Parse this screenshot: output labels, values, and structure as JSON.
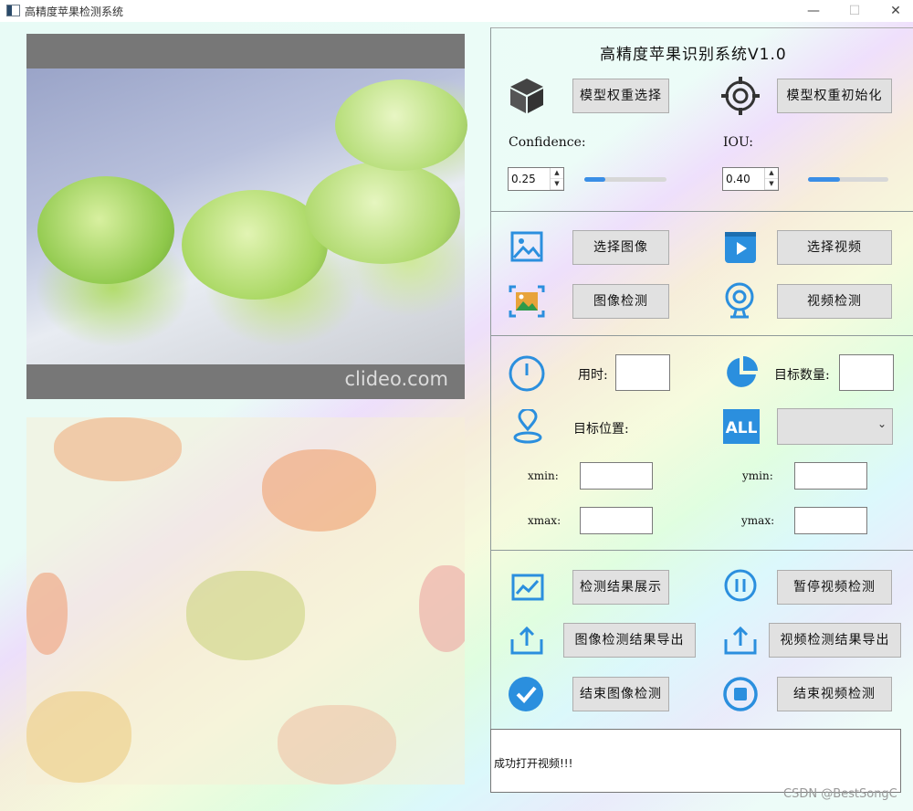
{
  "window": {
    "title": "高精度苹果检测系统",
    "controls": {
      "minimize": "—",
      "maximize": "☐",
      "close": "✕"
    }
  },
  "video": {
    "watermark": "clideo.com"
  },
  "app": {
    "heading": "高精度苹果识别系统V1.0"
  },
  "model": {
    "select_weights_label": "模型权重选择",
    "init_weights_label": "模型权重初始化"
  },
  "params": {
    "confidence_label": "Confidence:",
    "confidence_value": "0.25",
    "confidence_slider": 0.25,
    "iou_label": "IOU:",
    "iou_value": "0.40",
    "iou_slider": 0.4
  },
  "actions": {
    "select_image": "选择图像",
    "select_video": "选择视频",
    "detect_image": "图像检测",
    "detect_video": "视频检测"
  },
  "results": {
    "time_label": "用时:",
    "time_value": "",
    "count_label": "目标数量:",
    "count_value": "",
    "position_label": "目标位置:",
    "target_select_value": "",
    "xmin_label": "xmin:",
    "ymin_label": "ymin:",
    "xmax_label": "xmax:",
    "ymax_label": "ymax:",
    "xmin_value": "",
    "ymin_value": "",
    "xmax_value": "",
    "ymax_value": ""
  },
  "controls": {
    "show_results": "检测结果展示",
    "pause_video": "暂停视频检测",
    "export_image": "图像检测结果导出",
    "export_video": "视频检测结果导出",
    "end_image": "结束图像检测",
    "end_video": "结束视频检测"
  },
  "status": {
    "message": "成功打开视频!!!"
  },
  "watermark": {
    "text": "CSDN @BestSongC"
  },
  "colors": {
    "accent": "#2b8fde",
    "slider_fill": "#3a8ee6",
    "button_bg": "#e1e1e1"
  }
}
